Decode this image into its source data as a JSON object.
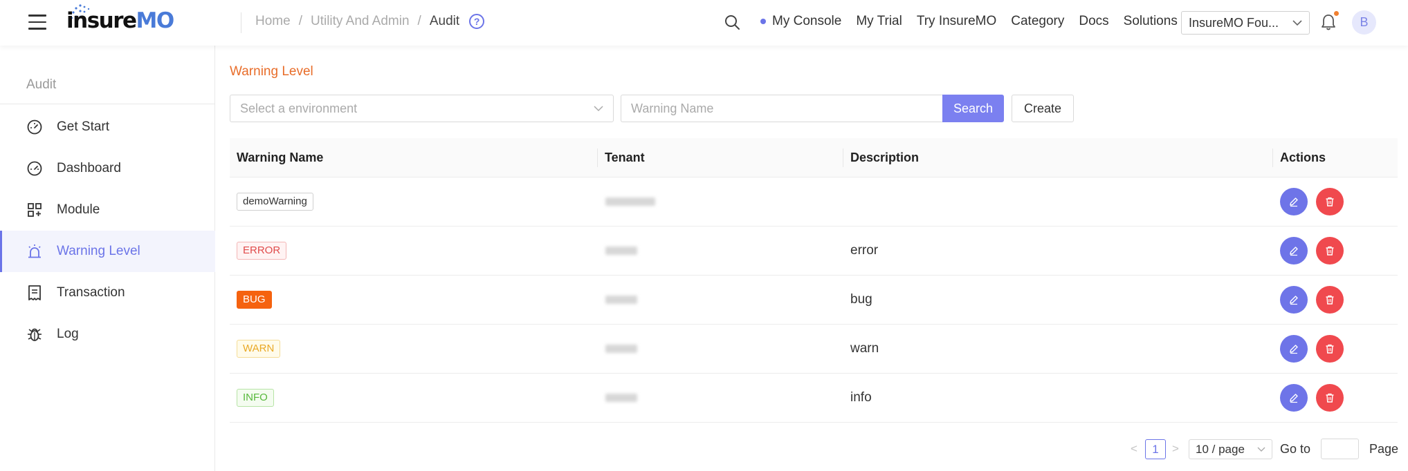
{
  "header": {
    "logo": {
      "part1": "insure",
      "part2": "MO"
    },
    "breadcrumb": [
      "Home",
      "Utility And Admin",
      "Audit"
    ],
    "breadcrumb_sep": "/",
    "help_glyph": "?",
    "nav": {
      "my_console": "My Console",
      "my_trial": "My Trial",
      "try_insuremo": "Try InsureMO",
      "category": "Category",
      "docs": "Docs",
      "solutions": "Solutions"
    },
    "env_selector": "InsureMO Fou...",
    "avatar_initial": "B",
    "icons": [
      "menu-icon",
      "search-icon",
      "bell-icon",
      "help-icon",
      "chevron-down-icon"
    ],
    "accent_color": "#6b74e8",
    "notification_dot_color": "#f08030"
  },
  "sidebar": {
    "title": "Audit",
    "items": [
      {
        "label": "Get Start",
        "icon": "gauge-icon",
        "active": false
      },
      {
        "label": "Dashboard",
        "icon": "gauge-icon",
        "active": false
      },
      {
        "label": "Module",
        "icon": "grid-icon",
        "active": false
      },
      {
        "label": "Warning Level",
        "icon": "alarm-icon",
        "active": true
      },
      {
        "label": "Transaction",
        "icon": "receipt-icon",
        "active": false
      },
      {
        "label": "Log",
        "icon": "bug-icon",
        "active": false
      }
    ]
  },
  "main": {
    "title": "Warning Level",
    "title_color": "#e86d2a",
    "filters": {
      "environment_placeholder": "Select a environment",
      "warning_name_placeholder": "Warning Name",
      "search_label": "Search",
      "create_label": "Create"
    },
    "table": {
      "columns": [
        "Warning Name",
        "Tenant",
        "Description",
        "Actions"
      ],
      "rows": [
        {
          "name": "demoWarning",
          "tag_style": "default",
          "tenant": "",
          "description": ""
        },
        {
          "name": "ERROR",
          "tag_style": "error",
          "tenant": "",
          "description": "error"
        },
        {
          "name": "BUG",
          "tag_style": "bug",
          "tenant": "",
          "description": "bug"
        },
        {
          "name": "WARN",
          "tag_style": "warn",
          "tenant": "",
          "description": "warn"
        },
        {
          "name": "INFO",
          "tag_style": "info",
          "tenant": "",
          "description": "info"
        }
      ],
      "row_actions": [
        "edit-icon",
        "trash-icon"
      ]
    },
    "pagination": {
      "prev": "<",
      "next": ">",
      "current_page": "1",
      "page_size": "10 / page",
      "goto_label": "Go to",
      "goto_value": "",
      "page_label": "Page"
    }
  }
}
